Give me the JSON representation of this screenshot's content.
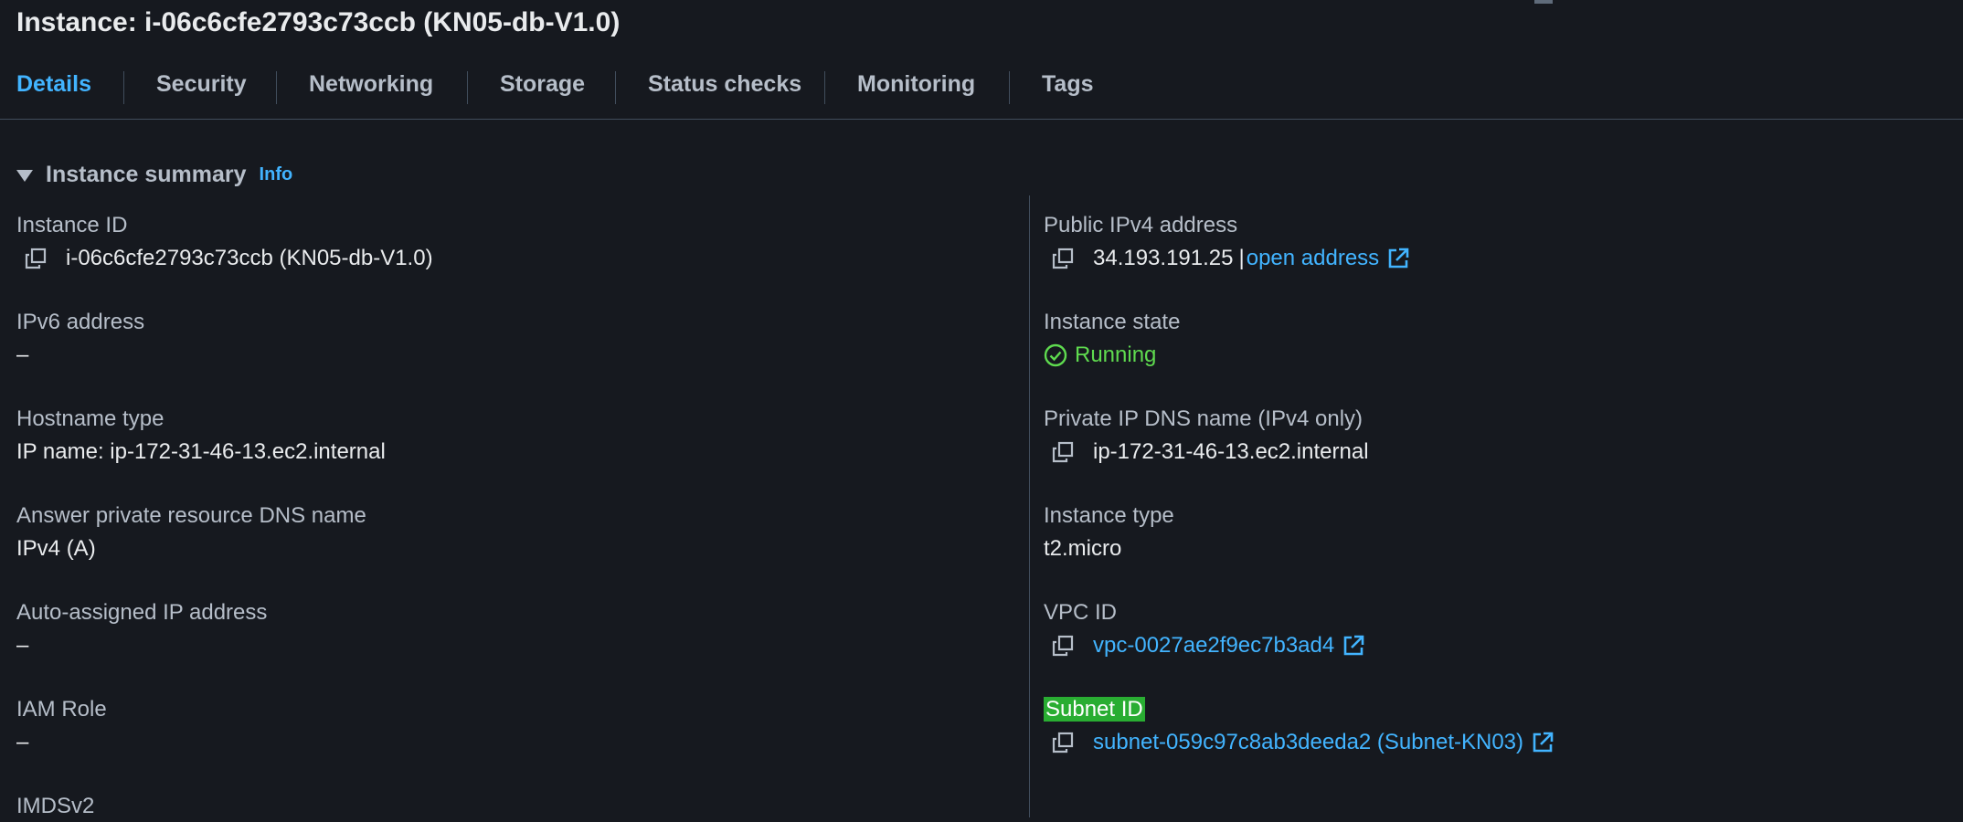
{
  "header": {
    "title": "Instance: i-06c6cfe2793c73ccb (KN05-db-V1.0)"
  },
  "tabs": [
    {
      "label": "Details",
      "active": true
    },
    {
      "label": "Security"
    },
    {
      "label": "Networking"
    },
    {
      "label": "Storage"
    },
    {
      "label": "Status checks"
    },
    {
      "label": "Monitoring"
    },
    {
      "label": "Tags"
    }
  ],
  "summary": {
    "title": "Instance summary",
    "info_label": "Info"
  },
  "left": {
    "instance_id": {
      "label": "Instance ID",
      "value": "i-06c6cfe2793c73ccb (KN05-db-V1.0)"
    },
    "ipv6": {
      "label": "IPv6 address",
      "value": "–"
    },
    "hostname_type": {
      "label": "Hostname type",
      "value": "IP name: ip-172-31-46-13.ec2.internal"
    },
    "answer_dns": {
      "label": "Answer private resource DNS name",
      "value": "IPv4 (A)"
    },
    "auto_ip": {
      "label": "Auto-assigned IP address",
      "value": "–"
    },
    "iam_role": {
      "label": "IAM Role",
      "value": "–"
    },
    "imdsv2": {
      "label": "IMDSv2"
    }
  },
  "right": {
    "public_ipv4": {
      "label": "Public IPv4 address",
      "value": "34.193.191.25",
      "separator": "|",
      "link": "open address"
    },
    "state": {
      "label": "Instance state",
      "value": "Running"
    },
    "private_dns": {
      "label": "Private IP DNS name (IPv4 only)",
      "value": "ip-172-31-46-13.ec2.internal"
    },
    "instance_type": {
      "label": "Instance type",
      "value": "t2.micro"
    },
    "vpc_id": {
      "label": "VPC ID",
      "value": "vpc-0027ae2f9ec7b3ad4"
    },
    "subnet_id": {
      "label": "Subnet ID",
      "value": "subnet-059c97c8ab3deeda2 (Subnet-KN03)"
    }
  },
  "colors": {
    "background": "#16191f",
    "link": "#42b4ff",
    "running": "#5fdb4f",
    "highlight": "#29ad32"
  },
  "icons": {
    "copy": "copy-icon",
    "external": "external-link-icon",
    "status": "check-circle-icon",
    "caret": "caret-down-icon"
  }
}
